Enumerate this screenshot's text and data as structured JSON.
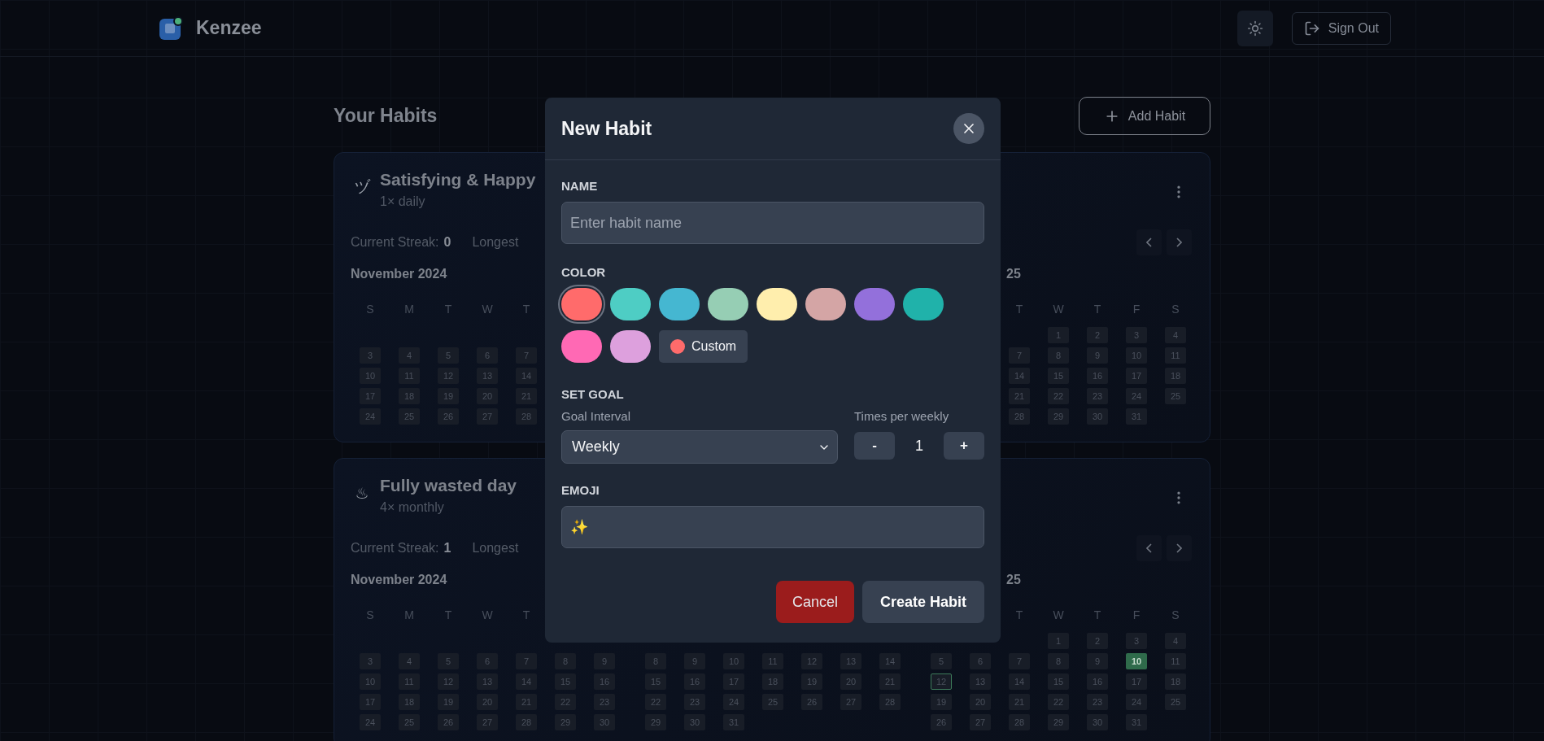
{
  "header": {
    "brand": "Kenzee",
    "sign_out": "Sign Out"
  },
  "page_title": "Your Habits",
  "add_button": "Add Habit",
  "habits": [
    {
      "emoji": "ヅ",
      "name": "Satisfying & Happy",
      "frequency": "1× daily",
      "streak_label": "Current Streak:",
      "streak": "0",
      "longest_label": "Longest",
      "months": [
        {
          "kind": "month",
          "title": "November 2024",
          "weekdays": [
            "S",
            "M",
            "T",
            "W",
            "T",
            {
              "kind": "blank"
            },
            {
              "kind": "blank"
            }
          ],
          "weeks": [
            [
              {
                "kind": "blank"
              },
              {
                "kind": "blank"
              },
              {
                "kind": "blank"
              },
              {
                "kind": "blank"
              },
              {
                "kind": "blank"
              },
              {
                "kind": "blank"
              },
              {
                "kind": "blank"
              }
            ],
            [
              "3",
              "4",
              "5",
              "6",
              "7",
              {
                "kind": "blank"
              },
              {
                "kind": "blank"
              }
            ],
            [
              "10",
              "11",
              "12",
              "13",
              "14",
              {
                "kind": "blank"
              },
              {
                "kind": "blank"
              }
            ],
            [
              "17",
              "18",
              "19",
              "20",
              "21",
              {
                "kind": "blank"
              },
              {
                "kind": "blank"
              }
            ],
            [
              "24",
              "25",
              "26",
              "27",
              "28",
              {
                "kind": "blank"
              },
              {
                "kind": "blank"
              }
            ]
          ]
        },
        {
          "kind": "covered"
        },
        {
          "kind": "month",
          "title": "25",
          "weekdays": [
            {
              "kind": "blank"
            },
            {
              "kind": "blank"
            },
            "T",
            "W",
            "T",
            "F",
            "S"
          ],
          "weeks": [
            [
              {
                "kind": "blank"
              },
              {
                "kind": "blank"
              },
              {
                "kind": "blank"
              },
              "1",
              "2",
              "3",
              "4"
            ],
            [
              {
                "kind": "blank"
              },
              {
                "kind": "blank"
              },
              "7",
              "8",
              "9",
              "10",
              "11"
            ],
            [
              {
                "kind": "blank"
              },
              {
                "kind": "blank"
              },
              "14",
              "15",
              "16",
              "17",
              "18"
            ],
            [
              {
                "kind": "blank"
              },
              {
                "kind": "blank"
              },
              "21",
              "22",
              "23",
              "24",
              "25"
            ],
            [
              {
                "kind": "blank"
              },
              {
                "kind": "blank"
              },
              "28",
              "29",
              "30",
              "31",
              {
                "kind": "blank"
              }
            ]
          ]
        }
      ]
    },
    {
      "emoji": "♨",
      "name": "Fully wasted day",
      "frequency": "4× monthly",
      "streak_label": "Current Streak:",
      "streak": "1",
      "longest_label": "Longest",
      "months": [
        {
          "kind": "month",
          "title": "November 2024",
          "weekdays": [
            "S",
            "M",
            "T",
            "W",
            "T",
            {
              "kind": "blank"
            },
            {
              "kind": "blank"
            }
          ],
          "weeks": [
            [
              {
                "kind": "blank"
              },
              {
                "kind": "blank"
              },
              {
                "kind": "blank"
              },
              {
                "kind": "blank"
              },
              {
                "kind": "blank"
              },
              {
                "kind": "blank"
              },
              {
                "kind": "blank"
              }
            ],
            [
              "3",
              "4",
              "5",
              "6",
              "7",
              "8",
              "9"
            ],
            [
              "10",
              "11",
              "12",
              "13",
              "14",
              "15",
              "16"
            ],
            [
              "17",
              "18",
              "19",
              "20",
              "21",
              "22",
              "23"
            ],
            [
              "24",
              "25",
              "26",
              "27",
              "28",
              "29",
              "30"
            ]
          ]
        },
        {
          "kind": "month",
          "weekdays": [
            {
              "kind": "blank"
            },
            {
              "kind": "blank"
            },
            {
              "kind": "blank"
            },
            {
              "kind": "blank"
            },
            {
              "kind": "blank"
            },
            {
              "kind": "blank"
            },
            {
              "kind": "blank"
            }
          ],
          "weeks": [
            [
              {
                "kind": "blank"
              },
              {
                "kind": "blank"
              },
              {
                "kind": "blank"
              },
              {
                "kind": "blank"
              },
              {
                "kind": "blank"
              },
              {
                "kind": "blank"
              },
              {
                "kind": "blank"
              }
            ],
            [
              "8",
              "9",
              "10",
              "11",
              "12",
              "13",
              "14"
            ],
            [
              "15",
              "16",
              "17",
              "18",
              "19",
              "20",
              "21"
            ],
            [
              "22",
              "23",
              "24",
              "25",
              "26",
              "27",
              "28"
            ],
            [
              "29",
              "30",
              "31",
              {
                "kind": "blank"
              },
              {
                "kind": "blank"
              },
              {
                "kind": "blank"
              },
              {
                "kind": "blank"
              }
            ]
          ]
        },
        {
          "kind": "month",
          "title": "25",
          "weekdays": [
            {
              "kind": "blank"
            },
            {
              "kind": "blank"
            },
            "T",
            "W",
            "T",
            "F",
            "S"
          ],
          "weeks": [
            [
              {
                "kind": "blank"
              },
              {
                "kind": "blank"
              },
              {
                "kind": "blank"
              },
              "1",
              "2",
              "3",
              "4"
            ],
            [
              "5",
              "6",
              "7",
              "8",
              "9",
              {
                "kind": "done",
                "day": "10"
              },
              "11"
            ],
            [
              {
                "kind": "today",
                "day": "12"
              },
              "13",
              "14",
              "15",
              "16",
              "17",
              "18"
            ],
            [
              "19",
              "20",
              "21",
              "22",
              "23",
              "24",
              "25"
            ],
            [
              "26",
              "27",
              "28",
              "29",
              "30",
              "31",
              {
                "kind": "blank"
              }
            ]
          ]
        }
      ]
    }
  ],
  "modal": {
    "title": "New Habit",
    "name_field": {
      "label": "NAME",
      "placeholder": "Enter habit name"
    },
    "color_label": "COLOR",
    "colors": [
      {
        "color": "#ff6b6b",
        "selected": true
      },
      {
        "color": "#4ecdc4",
        "selected": false
      },
      {
        "color": "#45b7d1",
        "selected": false
      },
      {
        "color": "#96ceb4",
        "selected": false
      },
      {
        "color": "#ffeead",
        "selected": false
      },
      {
        "color": "#d4a5a5",
        "selected": false
      },
      {
        "color": "#9370db",
        "selected": false
      },
      {
        "color": "#20b2aa",
        "selected": false
      },
      {
        "color": "#ff69b4",
        "selected": false
      },
      {
        "color": "#dda0dd",
        "selected": false
      }
    ],
    "custom": {
      "label": "Custom",
      "color": "#ff6b6b"
    },
    "goal_label": "SET GOAL",
    "interval": {
      "label": "Goal Interval",
      "value": "Weekly"
    },
    "times": {
      "label": "Times per weekly",
      "value": "1",
      "minus": "-",
      "plus": "+"
    },
    "emoji_field": {
      "label": "EMOJI",
      "value": "✨"
    },
    "buttons": [
      {
        "label": "Cancel",
        "kind": "cancel"
      },
      {
        "label": "Create Habit",
        "kind": "primary"
      }
    ]
  }
}
